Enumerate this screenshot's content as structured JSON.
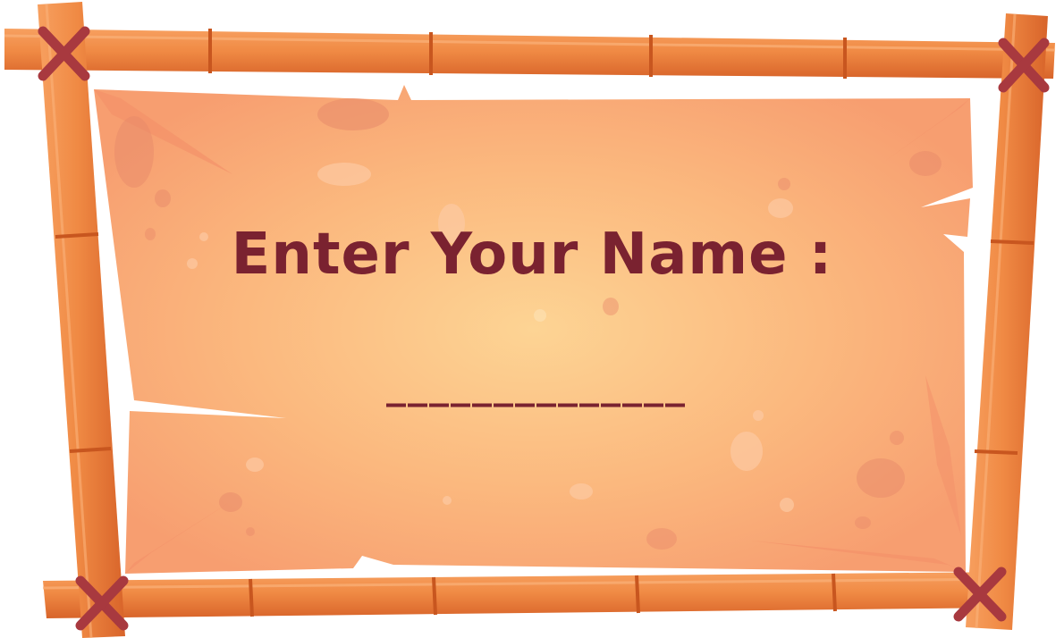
{
  "prompt": {
    "title": "Enter Your Name :",
    "input_placeholder": "______________",
    "input_value": ""
  },
  "colors": {
    "text": "#7a2230",
    "bamboo": "#f08a44",
    "bamboo_dark": "#d8642a",
    "parchment_center": "#fdd494",
    "parchment_edge": "#f79e70",
    "rope": "#a8393f"
  },
  "icons": {
    "corner_ties": "x-shaped rope tie"
  }
}
